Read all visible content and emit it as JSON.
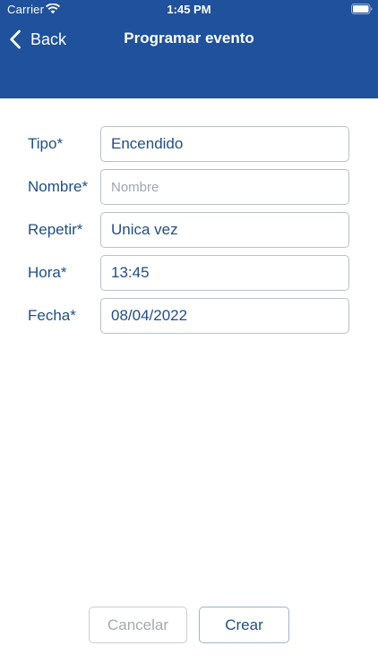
{
  "status_bar": {
    "carrier": "Carrier",
    "time": "1:45 PM",
    "wifi_icon": "wifi-icon",
    "battery_icon": "battery-icon"
  },
  "nav": {
    "back_label": "Back",
    "back_icon": "chevron-left-icon",
    "title": "Programar evento",
    "background_color": "#1f519c"
  },
  "form": {
    "tipo": {
      "label": "Tipo*",
      "value": "Encendido"
    },
    "nombre": {
      "label": "Nombre*",
      "value": "",
      "placeholder": "Nombre"
    },
    "repetir": {
      "label": "Repetir*",
      "value": "Unica vez"
    },
    "hora": {
      "label": "Hora*",
      "value": "13:45"
    },
    "fecha": {
      "label": "Fecha*",
      "value": "08/04/2022"
    }
  },
  "actions": {
    "cancel_label": "Cancelar",
    "create_label": "Crear"
  },
  "colors": {
    "accent": "#1f4d8a",
    "disabled_text": "#a4a9af"
  }
}
